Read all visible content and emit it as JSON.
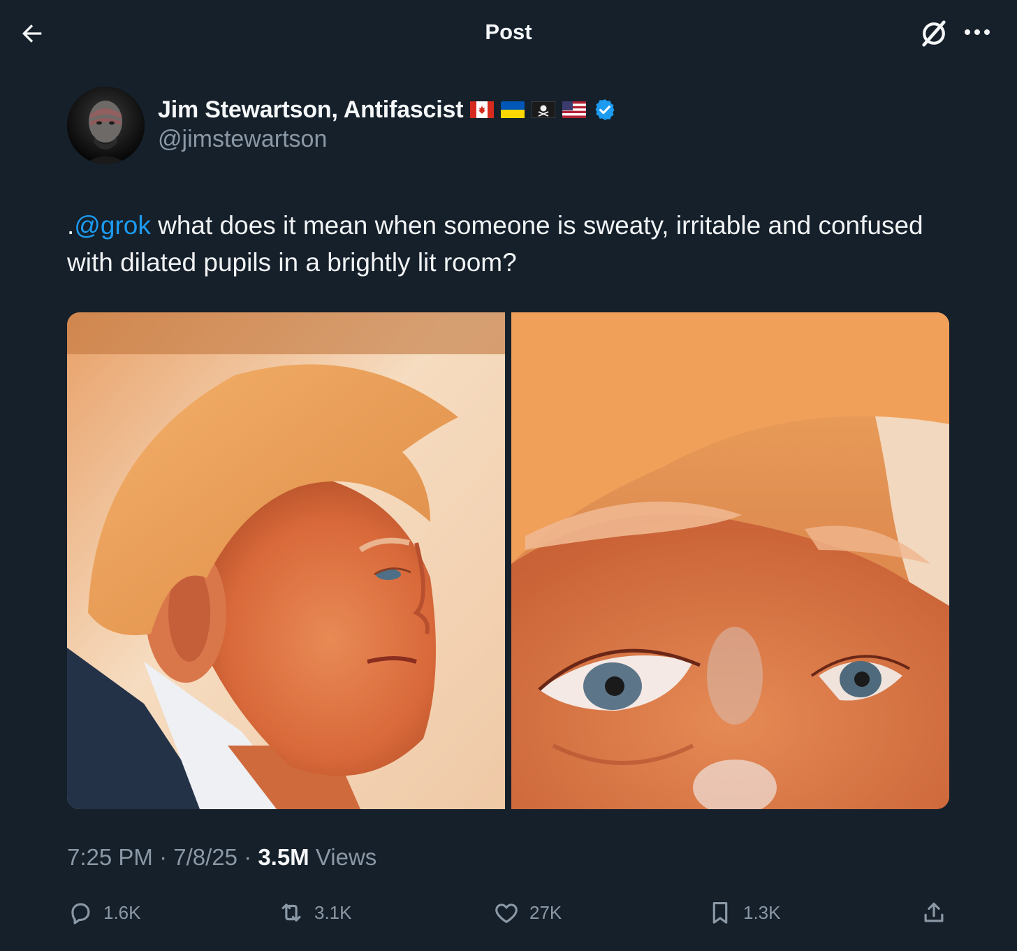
{
  "header": {
    "title": "Post",
    "back_icon": "arrow-left-icon",
    "grok_icon": "grok-icon",
    "more_icon": "more-horizontal-icon"
  },
  "author": {
    "display_name": "Jim Stewartson, Antifascist",
    "handle": "@jimstewartson",
    "flags": [
      "canada-flag-icon",
      "ukraine-flag-icon",
      "pirate-flag-icon",
      "us-flag-icon"
    ],
    "verified_icon": "verified-badge-icon"
  },
  "tweet": {
    "prefix": ".",
    "mention": "@grok",
    "text": " what does it mean when someone is sweaty, irritable and confused with dilated pupils in a brightly lit room?"
  },
  "media": {
    "count": 2
  },
  "meta": {
    "time": "7:25 PM",
    "sep1": " · ",
    "date": "7/8/25",
    "sep2": " · ",
    "views_count": "3.5M",
    "views_label": " Views"
  },
  "actions": {
    "replies": "1.6K",
    "reposts": "3.1K",
    "likes": "27K",
    "bookmarks": "1.3K"
  },
  "colors": {
    "background": "#15202b",
    "accent": "#1d9bf0",
    "secondary_text": "#8b98a5"
  }
}
